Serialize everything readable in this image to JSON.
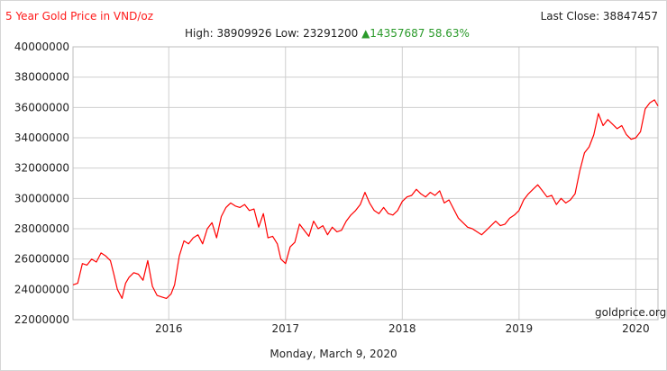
{
  "header": {
    "title": "5 Year Gold Price in VND/oz",
    "last_close_label": "Last Close: 38847457",
    "stats_text": "High: 38909926 Low: 23291200",
    "change_text": "▲14357687 58.63%"
  },
  "footer": {
    "date": "Monday, March 9, 2020",
    "watermark": "goldprice.org"
  },
  "colors": {
    "line": "#ff0000",
    "title": "#ff1a1a",
    "change": "#2a9a2a",
    "grid": "#cfcfcf"
  },
  "chart_data": {
    "type": "line",
    "title": "5 Year Gold Price in VND/oz",
    "xlabel": "",
    "ylabel": "",
    "ylim": [
      22000000,
      40000000
    ],
    "xlim": [
      2015.18,
      2020.19
    ],
    "grid": true,
    "y_ticks": [
      22000000,
      24000000,
      26000000,
      28000000,
      30000000,
      32000000,
      34000000,
      36000000,
      38000000,
      40000000
    ],
    "y_tick_labels": [
      "22000000",
      "24000000",
      "26000000",
      "28000000",
      "30000000",
      "32000000",
      "34000000",
      "36000000",
      "38000000",
      "40000000"
    ],
    "x_ticks": [
      2016,
      2017,
      2018,
      2019,
      2020
    ],
    "x_tick_labels": [
      "2016",
      "2017",
      "2018",
      "2019",
      "2020"
    ],
    "series": [
      {
        "x": [
          2015.18,
          2015.22,
          2015.26,
          2015.3,
          2015.34,
          2015.38,
          2015.42,
          2015.46,
          2015.5,
          2015.53,
          2015.56,
          2015.6,
          2015.63,
          2015.66,
          2015.7,
          2015.74,
          2015.78,
          2015.82,
          2015.86,
          2015.9,
          2015.94,
          2015.98,
          2016.02,
          2016.05,
          2016.09,
          2016.13,
          2016.17,
          2016.21,
          2016.25,
          2016.29,
          2016.33,
          2016.37,
          2016.41,
          2016.45,
          2016.49,
          2016.53,
          2016.57,
          2016.61,
          2016.65,
          2016.69,
          2016.73,
          2016.77,
          2016.81,
          2016.85,
          2016.89,
          2016.93,
          2016.96,
          2017.0,
          2017.04,
          2017.08,
          2017.12,
          2017.16,
          2017.2,
          2017.24,
          2017.28,
          2017.32,
          2017.36,
          2017.4,
          2017.44,
          2017.48,
          2017.52,
          2017.56,
          2017.6,
          2017.64,
          2017.68,
          2017.72,
          2017.76,
          2017.8,
          2017.84,
          2017.88,
          2017.92,
          2017.96,
          2018.0,
          2018.04,
          2018.08,
          2018.12,
          2018.16,
          2018.2,
          2018.24,
          2018.28,
          2018.32,
          2018.36,
          2018.4,
          2018.44,
          2018.48,
          2018.52,
          2018.56,
          2018.6,
          2018.64,
          2018.68,
          2018.72,
          2018.76,
          2018.8,
          2018.84,
          2018.88,
          2018.92,
          2018.96,
          2019.0,
          2019.04,
          2019.08,
          2019.12,
          2019.16,
          2019.2,
          2019.24,
          2019.28,
          2019.32,
          2019.36,
          2019.4,
          2019.44,
          2019.48,
          2019.52,
          2019.56,
          2019.6,
          2019.64,
          2019.68,
          2019.72,
          2019.76,
          2019.8,
          2019.84,
          2019.88,
          2019.92,
          2019.96,
          2020.0,
          2020.04,
          2020.08,
          2020.12,
          2020.16,
          2020.19
        ],
        "y": [
          24300000,
          24400000,
          25700000,
          25600000,
          26000000,
          25800000,
          26400000,
          26200000,
          25900000,
          25000000,
          24000000,
          23400000,
          24400000,
          24800000,
          25100000,
          25000000,
          24600000,
          25900000,
          24200000,
          23600000,
          23500000,
          23400000,
          23700000,
          24300000,
          26200000,
          27200000,
          27000000,
          27400000,
          27600000,
          27000000,
          28000000,
          28400000,
          27400000,
          28800000,
          29400000,
          29700000,
          29500000,
          29400000,
          29600000,
          29200000,
          29300000,
          28100000,
          29000000,
          27400000,
          27500000,
          27000000,
          26000000,
          25700000,
          26800000,
          27100000,
          28300000,
          27900000,
          27500000,
          28500000,
          28000000,
          28200000,
          27600000,
          28100000,
          27800000,
          27900000,
          28500000,
          28900000,
          29200000,
          29600000,
          30400000,
          29700000,
          29200000,
          29000000,
          29400000,
          29000000,
          28900000,
          29200000,
          29800000,
          30100000,
          30200000,
          30600000,
          30300000,
          30100000,
          30400000,
          30200000,
          30500000,
          29700000,
          29900000,
          29300000,
          28700000,
          28400000,
          28100000,
          28000000,
          27800000,
          27600000,
          27900000,
          28200000,
          28500000,
          28200000,
          28300000,
          28700000,
          28900000,
          29200000,
          29900000,
          30300000,
          30600000,
          30900000,
          30500000,
          30100000,
          30200000,
          29600000,
          30000000,
          29700000,
          29900000,
          30300000,
          31800000,
          33000000,
          33400000,
          34200000,
          35600000,
          34800000,
          35200000,
          34900000,
          34600000,
          34800000,
          34200000,
          33900000,
          34000000,
          34400000,
          35900000,
          36300000,
          36500000,
          36100000
        ]
      }
    ]
  }
}
